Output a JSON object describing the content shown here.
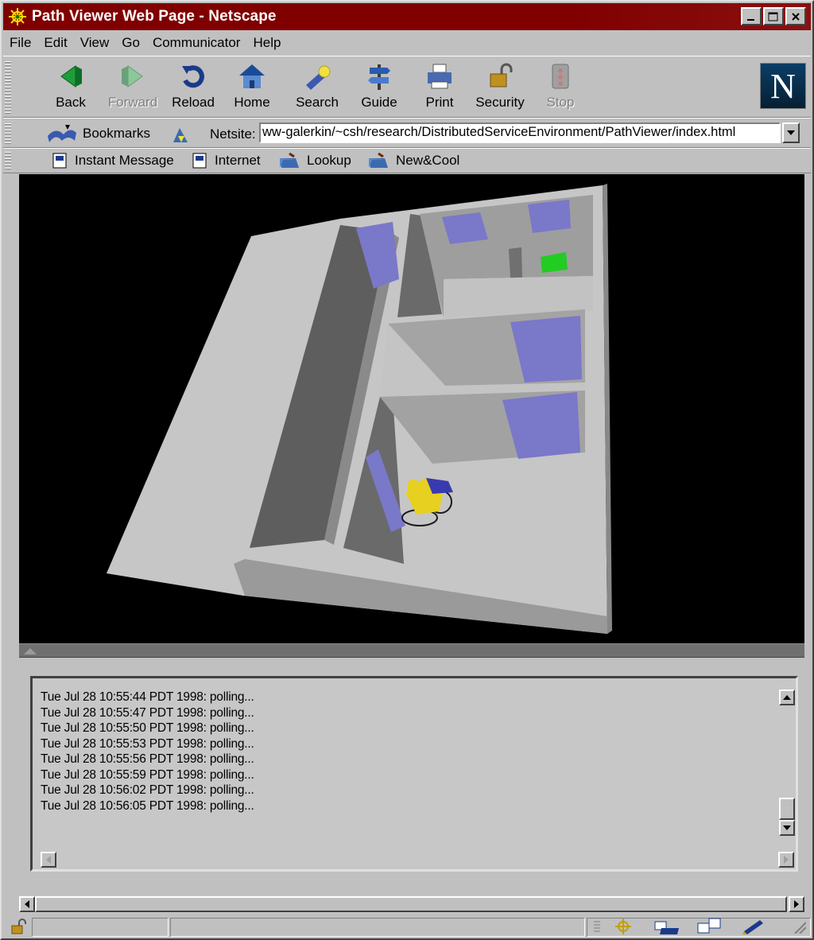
{
  "window": {
    "title": "Path Viewer Web Page - Netscape"
  },
  "menu": [
    "File",
    "Edit",
    "View",
    "Go",
    "Communicator",
    "Help"
  ],
  "navigation": {
    "back": "Back",
    "forward": "Forward",
    "reload": "Reload",
    "home": "Home",
    "search": "Search",
    "guide": "Guide",
    "print": "Print",
    "security": "Security",
    "stop": "Stop"
  },
  "location": {
    "bookmarks": "Bookmarks",
    "netsite_label": "Netsite:",
    "url": "ww-galerkin/~csh/research/DistributedServiceEnvironment/PathViewer/index.html"
  },
  "personal_toolbar": {
    "items": [
      "Instant Message",
      "Internet",
      "Lookup",
      "New&Cool"
    ]
  },
  "log": {
    "lines": [
      "Tue Jul 28 10:55:44 PDT 1998: polling...",
      "Tue Jul 28 10:55:47 PDT 1998: polling...",
      "Tue Jul 28 10:55:50 PDT 1998: polling...",
      "Tue Jul 28 10:55:53 PDT 1998: polling...",
      "Tue Jul 28 10:55:56 PDT 1998: polling...",
      "Tue Jul 28 10:55:59 PDT 1998: polling...",
      "Tue Jul 28 10:56:02 PDT 1998: polling...",
      "Tue Jul 28 10:56:05 PDT 1998: polling..."
    ]
  },
  "colors": {
    "titlebar": "#800000",
    "chrome": "#c0c0c0",
    "scene_bg": "#000000",
    "wall": "#c8c8c8",
    "window_pane": "#7a78c8",
    "marker": "#22cc22",
    "figure": "#e8d020"
  }
}
